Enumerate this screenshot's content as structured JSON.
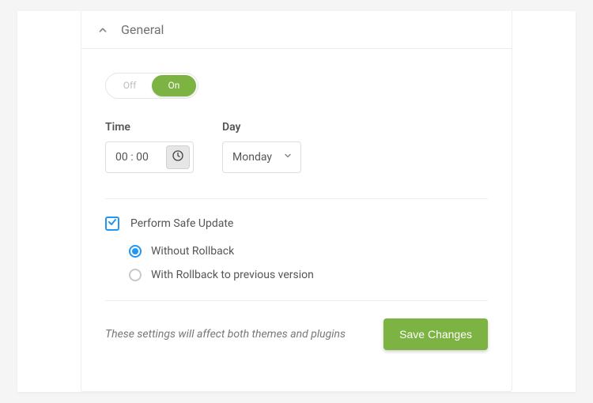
{
  "panel": {
    "title": "General"
  },
  "toggle": {
    "off_label": "Off",
    "on_label": "On",
    "state": "on"
  },
  "time": {
    "label": "Time",
    "value": "00 : 00"
  },
  "day": {
    "label": "Day",
    "selected": "Monday"
  },
  "safe_update": {
    "label": "Perform Safe Update",
    "checked": true
  },
  "rollback": {
    "without": "Without Rollback",
    "with": "With Rollback to previous version",
    "selected": "without"
  },
  "footer": {
    "note": "These settings will affect both themes and plugins",
    "save_label": "Save Changes"
  }
}
